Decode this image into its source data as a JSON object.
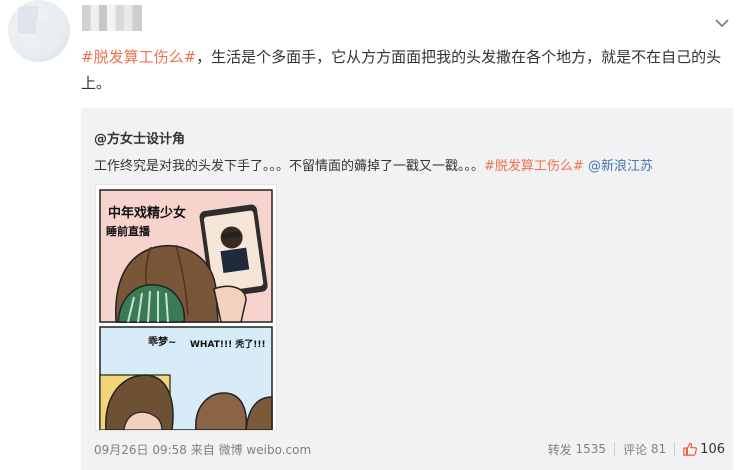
{
  "post": {
    "text_parts": {
      "topic": "#脱发算工伤么#",
      "body": "，生活是个多面手，它从方方面面把我的头发撒在各个地方，就是不在自己的头上。"
    }
  },
  "repost": {
    "author": "@方女士设计角",
    "text": "工作终究是对我的头发下手了。。。不留情面的薅掉了一戳又一戳。。。",
    "topic": "#脱发算工伤么#",
    "mention": "@新浪江苏",
    "comic": {
      "panel1_caption": "中年戏精少女",
      "panel1_caption2": "睡前直播",
      "panel2_bubble1": "乖梦~",
      "panel2_bubble2": "WHAT!!! 秃了!!!"
    },
    "meta": {
      "date": "09月26日 09:58",
      "from_label": "来自",
      "source": "微博 weibo.com"
    },
    "actions": {
      "repost_label": "转发",
      "repost_count": "1535",
      "comment_label": "评论",
      "comment_count": "81",
      "like_count": "106"
    }
  },
  "colors": {
    "topic": "#eb7350",
    "link": "#4477aa",
    "repost_bg": "#f2f2f5"
  }
}
